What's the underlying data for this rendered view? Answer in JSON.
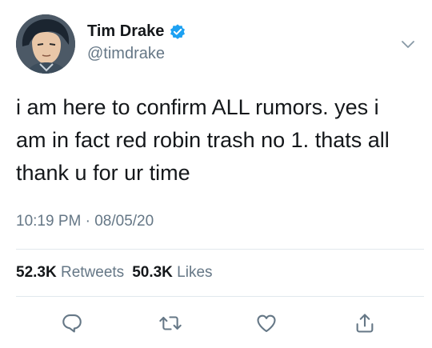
{
  "user": {
    "display_name": "Tim Drake",
    "handle": "@timdrake",
    "verified": true
  },
  "tweet": {
    "lines": [
      "i am here to confirm ALL rumors. yes i",
      "am in fact red robin trash no 1. thats all",
      "thank u for ur time"
    ],
    "timestamp": "10:19 PM · 08/05/20"
  },
  "stats": {
    "retweets_count": "52.3K",
    "retweets_label": "Retweets",
    "likes_count": "50.3K",
    "likes_label": "Likes"
  },
  "icons": {
    "reply": "reply-icon",
    "retweet": "retweet-icon",
    "like": "like-icon",
    "share": "share-icon",
    "more": "chevron-down-icon",
    "verified": "verified-badge-icon"
  },
  "colors": {
    "text_primary": "#14171a",
    "text_secondary": "#657786",
    "accent": "#1da1f2",
    "divider": "#e1e8ed"
  }
}
